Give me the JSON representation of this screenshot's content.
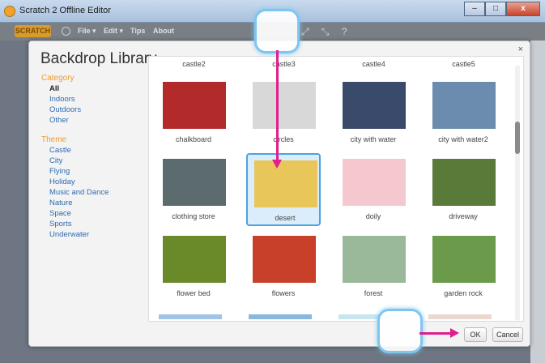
{
  "window": {
    "title": "Scratch 2 Offline Editor",
    "minimize": "–",
    "maximize": "□",
    "close": "x"
  },
  "menubar": {
    "logo": "SCRATCH",
    "items": [
      "File ▾",
      "Edit ▾",
      "Tips",
      "About"
    ],
    "tools": "⤢ ⤡ ?"
  },
  "dialog": {
    "title": "Backdrop Library",
    "close": "×",
    "category_heading": "Category",
    "categories": [
      "All",
      "Indoors",
      "Outdoors",
      "Other"
    ],
    "theme_heading": "Theme",
    "themes": [
      "Castle",
      "City",
      "Flying",
      "Holiday",
      "Music and Dance",
      "Nature",
      "Space",
      "Sports",
      "Underwater"
    ],
    "top_labels": [
      "castle2",
      "castle3",
      "castle4",
      "castle5"
    ],
    "tiles": [
      {
        "label": "chalkboard",
        "color": "#b22a2a"
      },
      {
        "label": "circles",
        "color": "#d8d8d8"
      },
      {
        "label": "city with water",
        "color": "#3a4a6a"
      },
      {
        "label": "city with water2",
        "color": "#6b8cae"
      },
      {
        "label": "clothing store",
        "color": "#5b6b6e"
      },
      {
        "label": "desert",
        "color": "#e8c65a"
      },
      {
        "label": "doily",
        "color": "#f5c8d0"
      },
      {
        "label": "driveway",
        "color": "#5a7a3a"
      },
      {
        "label": "flower bed",
        "color": "#6a8a2a"
      },
      {
        "label": "flowers",
        "color": "#c8402a"
      },
      {
        "label": "forest",
        "color": "#9ab89a"
      },
      {
        "label": "garden rock",
        "color": "#6a9a4a"
      }
    ],
    "ok": "OK",
    "cancel": "Cancel"
  }
}
